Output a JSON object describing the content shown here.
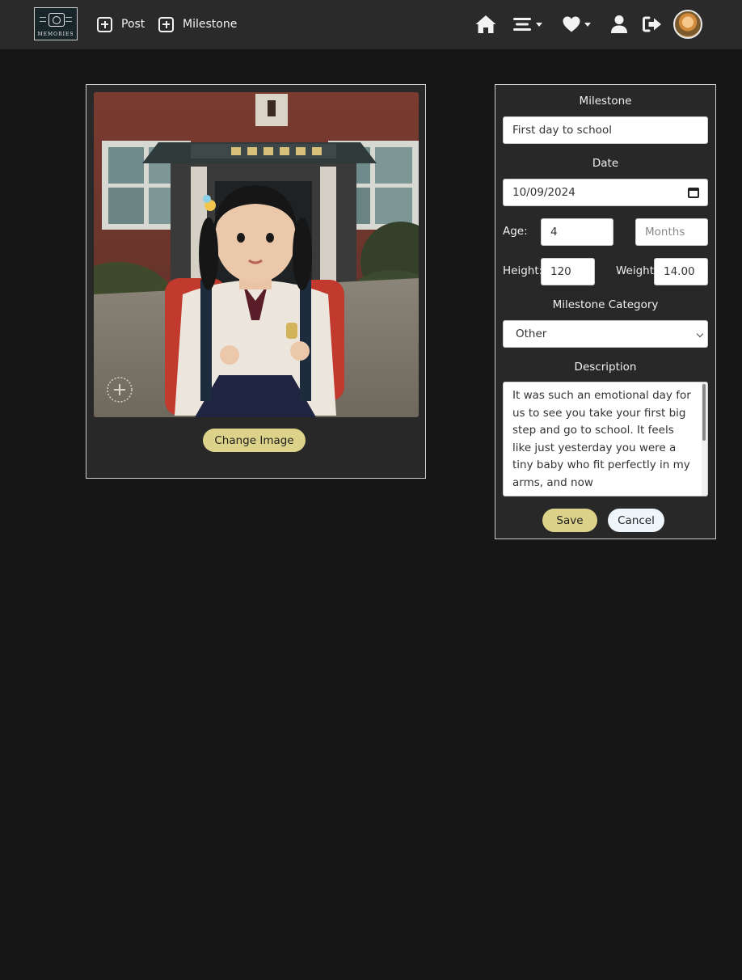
{
  "nav": {
    "logo_text": "MEMORIES",
    "post_label": "Post",
    "milestone_label": "Milestone"
  },
  "icons": [
    "plus-square-icon",
    "home-icon",
    "menu-icon",
    "heart-icon",
    "user-icon",
    "logout-icon",
    "avatar"
  ],
  "photo_card": {
    "change_image_label": "Change Image"
  },
  "form": {
    "milestone_label": "Milestone",
    "milestone_value": "First day to school",
    "date_label": "Date",
    "date_value": "10/09/2024",
    "age_label": "Age:",
    "age_value": "4",
    "months_placeholder": "Months",
    "height_label": "Height:",
    "height_value": "120",
    "weight_label": "Weight:",
    "weight_value": "14.00",
    "category_label": "Milestone Category",
    "category_value": "Other",
    "description_label": "Description",
    "description_value": "It was such an emotional day for us to see you take your first big step and go to school. It feels like just yesterday you were a tiny baby who fit perfectly in my arms, and now",
    "save_label": "Save",
    "cancel_label": "Cancel"
  },
  "colors": {
    "background": "#161616",
    "navbar": "#2a2a2a",
    "card": "#282828",
    "accent_button": "#ddd289",
    "cancel_button": "#eef5fb"
  }
}
